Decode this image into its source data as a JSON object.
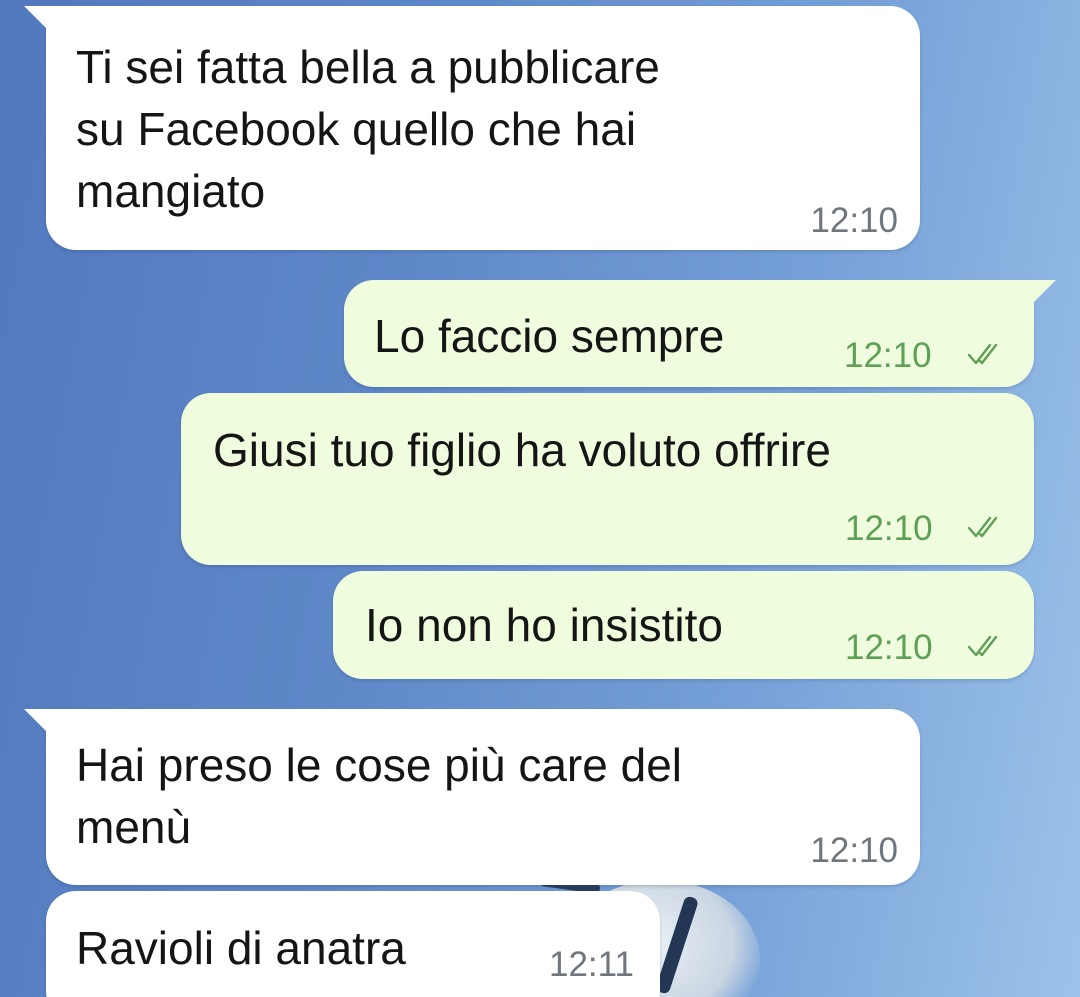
{
  "chat": {
    "messages": [
      {
        "direction": "incoming",
        "text": "Ti sei fatta bella a pubblicare\nsu Facebook quello che hai\nmangiato",
        "time": "12:10"
      },
      {
        "direction": "outgoing",
        "text": "Lo faccio sempre",
        "time": "12:10",
        "status": "read-double-check-icon"
      },
      {
        "direction": "outgoing",
        "text": "Giusi tuo figlio ha voluto offrire",
        "time": "12:10",
        "status": "read-double-check-icon"
      },
      {
        "direction": "outgoing",
        "text": "Io non ho insistito",
        "time": "12:10",
        "status": "read-double-check-icon"
      },
      {
        "direction": "incoming",
        "text": "Hai preso le cose più care del\nmenù",
        "time": "12:10"
      },
      {
        "direction": "incoming",
        "text": "Ravioli di anatra",
        "time": "12:11"
      }
    ]
  },
  "colors": {
    "incoming_bubble": "#ffffff",
    "outgoing_bubble": "#effdde",
    "outgoing_time": "#5f9f56",
    "incoming_time": "#6f767d",
    "check_marks": "#5f9f56"
  }
}
